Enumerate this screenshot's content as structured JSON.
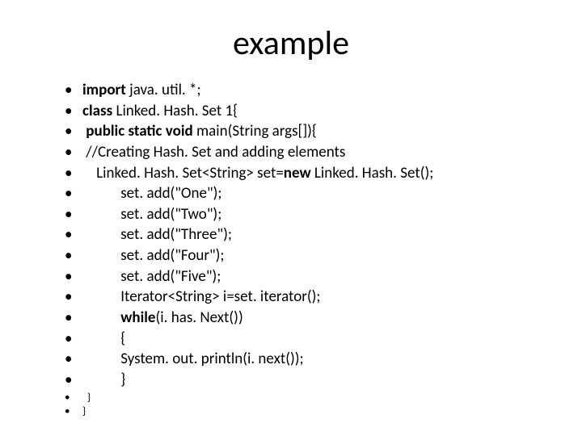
{
  "title": "example",
  "lines": [
    {
      "segments": [
        {
          "text": "import ",
          "bold": true
        },
        {
          "text": "java. util. *;"
        }
      ]
    },
    {
      "segments": [
        {
          "text": "class ",
          "bold": true
        },
        {
          "text": "Linked. Hash. Set 1{"
        }
      ]
    },
    {
      "segments": [
        {
          "text": " ",
          "bold": true
        },
        {
          "text": "public static void ",
          "bold": true
        },
        {
          "text": "main(String args[]){"
        }
      ]
    },
    {
      "segments": [
        {
          "text": " //Creating Hash. Set and adding elements"
        }
      ]
    },
    {
      "segments": [
        {
          "text": "    Linked. Hash. Set<String> set="
        },
        {
          "text": "new ",
          "bold": true
        },
        {
          "text": "Linked. Hash. Set();"
        }
      ]
    },
    {
      "segments": [
        {
          "text": "           set. add(\"One\");"
        }
      ]
    },
    {
      "segments": [
        {
          "text": "           set. add(\"Two\");"
        }
      ]
    },
    {
      "segments": [
        {
          "text": "           set. add(\"Three\");"
        }
      ]
    },
    {
      "segments": [
        {
          "text": "           set. add(\"Four\");"
        }
      ]
    },
    {
      "segments": [
        {
          "text": "           set. add(\"Five\");"
        }
      ]
    },
    {
      "segments": [
        {
          "text": "           Iterator<String> i=set. iterator();"
        }
      ]
    },
    {
      "segments": [
        {
          "text": "           while",
          "bold": true
        },
        {
          "text": "(i. has. Next())"
        }
      ]
    },
    {
      "segments": [
        {
          "text": "           {"
        }
      ]
    },
    {
      "segments": [
        {
          "text": "           System. out. println(i. next());"
        }
      ]
    },
    {
      "segments": [
        {
          "text": "           }"
        }
      ]
    },
    {
      "small": true,
      "segments": [
        {
          "text": "  }"
        }
      ]
    },
    {
      "small": true,
      "segments": [
        {
          "text": "}"
        }
      ]
    }
  ]
}
